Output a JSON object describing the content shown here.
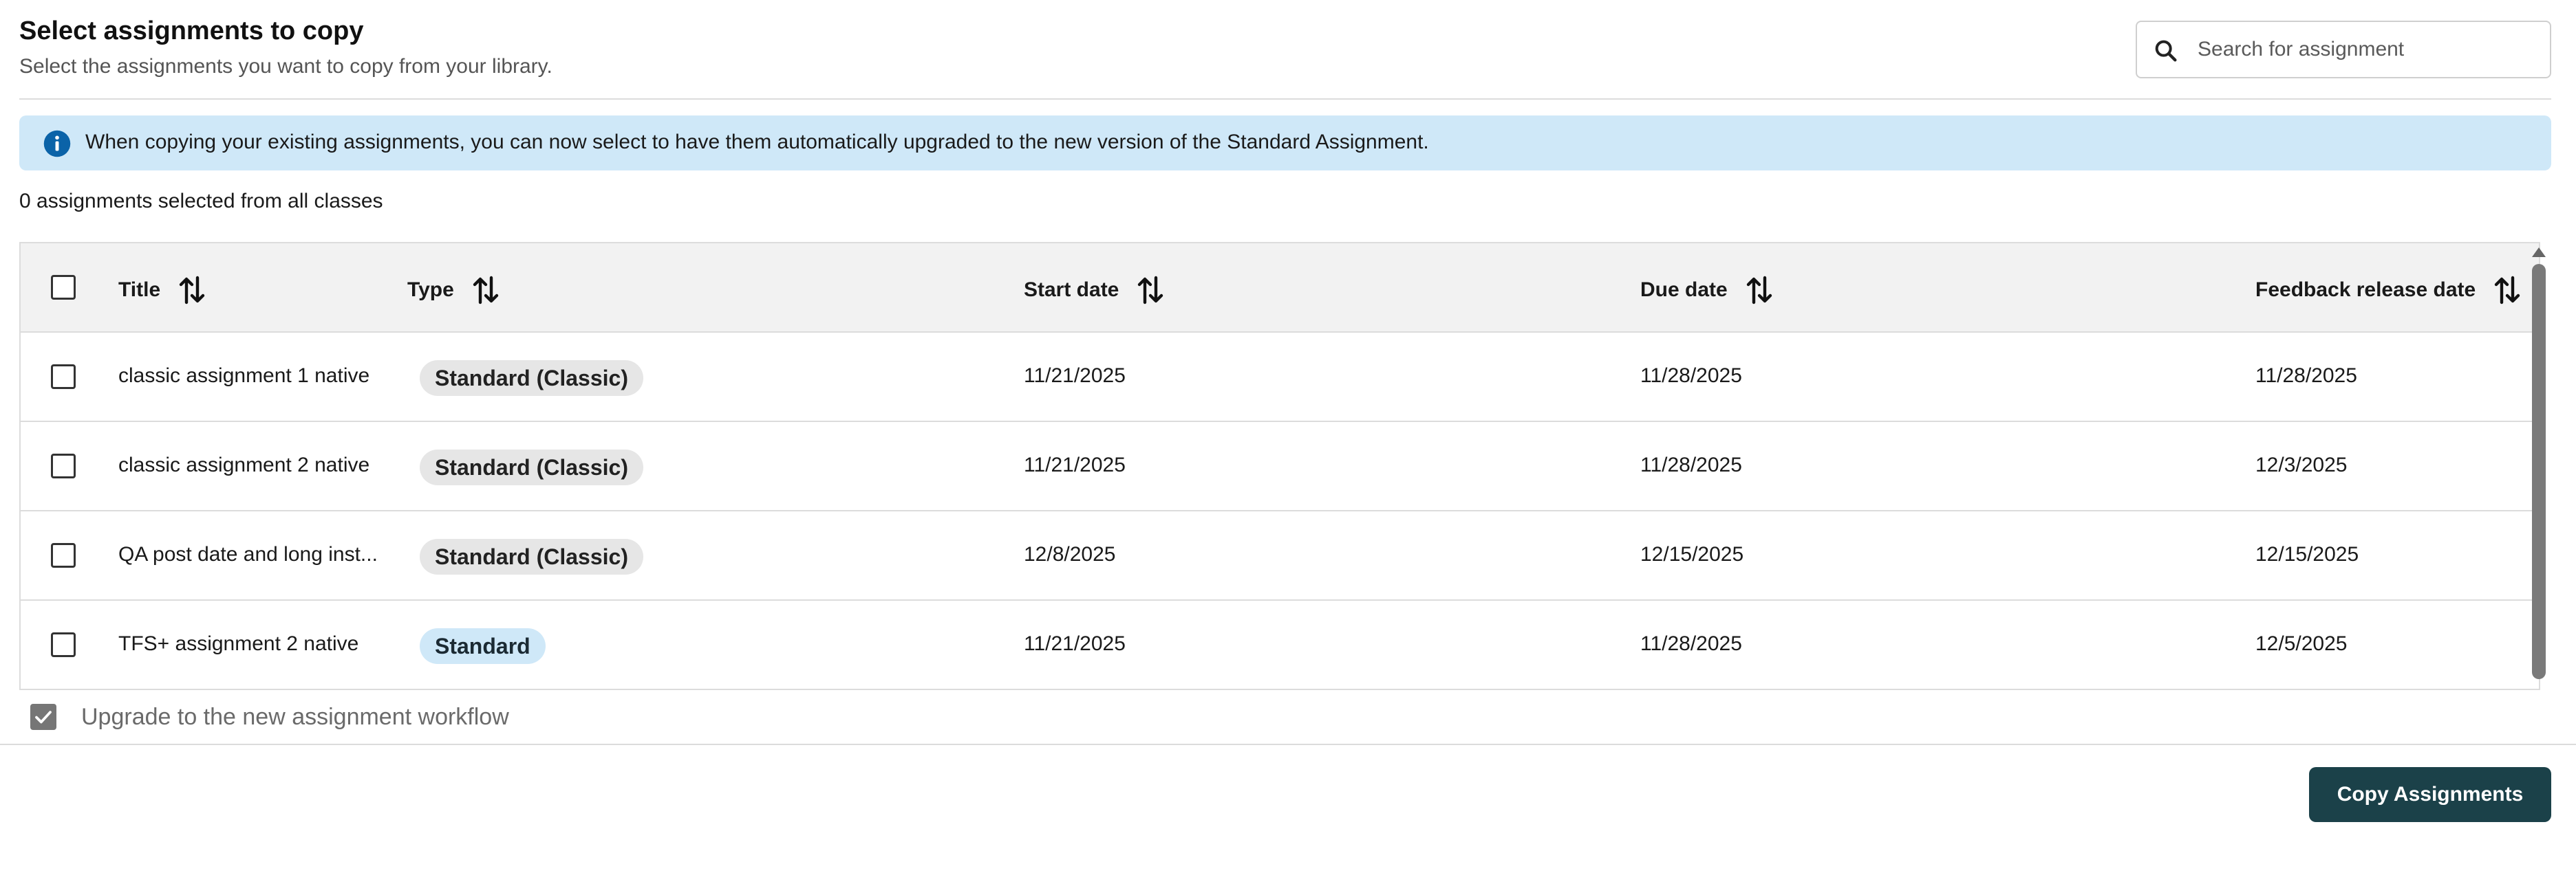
{
  "header": {
    "title": "Select assignments to copy",
    "subtitle": "Select the assignments you want to copy from your library."
  },
  "search": {
    "placeholder": "Search for assignment",
    "value": "",
    "icon": "search-icon"
  },
  "banner": {
    "icon": "info-icon",
    "text": "When copying your existing assignments, you can now select to have them automatically upgraded to the new version of the Standard Assignment."
  },
  "selection": {
    "count_text": "0 assignments selected from all classes"
  },
  "table": {
    "columns": [
      {
        "label": "Title"
      },
      {
        "label": "Type"
      },
      {
        "label": "Start date"
      },
      {
        "label": "Due date"
      },
      {
        "label": "Feedback release date"
      }
    ],
    "rows": [
      {
        "title": "classic assignment 1 native",
        "type": "Standard (Classic)",
        "start": "11/21/2025",
        "due": "11/28/2025",
        "feedback": "11/28/2025"
      },
      {
        "title": "classic assignment 2 native",
        "type": "Standard (Classic)",
        "start": "11/21/2025",
        "due": "11/28/2025",
        "feedback": "12/3/2025"
      },
      {
        "title": "QA post date and long inst...",
        "type": "Standard (Classic)",
        "start": "12/8/2025",
        "due": "12/15/2025",
        "feedback": "12/15/2025"
      },
      {
        "title": "TFS+ assignment 2 native",
        "type": "Standard",
        "start": "11/21/2025",
        "due": "11/28/2025",
        "feedback": "12/5/2025"
      }
    ]
  },
  "upgrade": {
    "label": "Upgrade to the new assignment workflow",
    "checked": true
  },
  "footer": {
    "copy_label": "Copy Assignments"
  },
  "colors": {
    "banner_bg": "#cfe8f8",
    "info_icon": "#0b63a8",
    "primary_button": "#1b4149",
    "badge_classic": "#e6e6e6",
    "badge_standard": "#cfe8f8"
  }
}
